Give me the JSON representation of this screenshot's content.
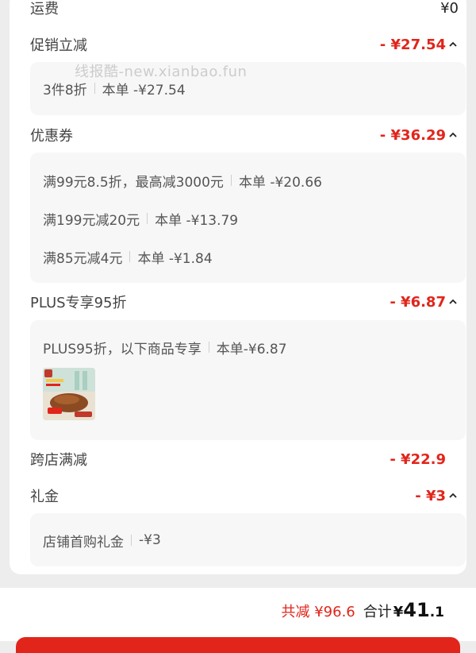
{
  "shipping": {
    "label": "运费",
    "amount": "¥0"
  },
  "promo": {
    "label": "促销立减",
    "amount": "- ¥27.54",
    "detail": {
      "name": "3件8折",
      "value": "本单 -¥27.54"
    }
  },
  "watermark": "线报酷-new.xianbao.fun",
  "coupon": {
    "label": "优惠券",
    "amount": "- ¥36.29",
    "items": [
      {
        "name": "满99元8.5折，最高减3000元",
        "value": "本单 -¥20.66"
      },
      {
        "name": "满199元减20元",
        "value": "本单 -¥13.79"
      },
      {
        "name": "满85元减4元",
        "value": "本单 -¥1.84"
      }
    ]
  },
  "plus": {
    "label": "PLUS专享95折",
    "amount": "- ¥6.87",
    "detail": {
      "name": "PLUS95折，以下商品专享",
      "value": "本单-¥6.87"
    }
  },
  "crossstore": {
    "label": "跨店满减",
    "amount": "- ¥22.9"
  },
  "gift": {
    "label": "礼金",
    "amount": "- ¥3",
    "detail": {
      "name": "店铺首购礼金",
      "value": "-¥3"
    }
  },
  "footer": {
    "saved": "共减 ¥96.6",
    "total_label": "合计",
    "currency": "¥",
    "total_int": "41",
    "total_dec": ".1"
  },
  "colors": {
    "accent": "#e1251b",
    "panel": "#f7f7f7",
    "background": "#ededed"
  }
}
